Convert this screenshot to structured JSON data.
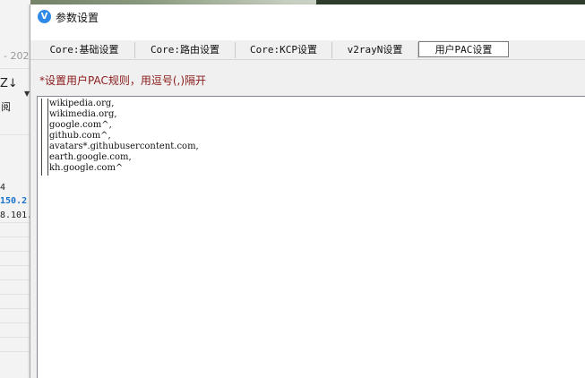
{
  "background_app": {
    "date_fragment": "- 202",
    "sort_icon_glyph": "Z↓",
    "sort_label": "阅",
    "rows": [
      "4",
      "150.2",
      "8.101."
    ]
  },
  "dialog": {
    "title": "参数设置",
    "tabs": [
      {
        "label": "Core:基础设置",
        "active": false
      },
      {
        "label": "Core:路由设置",
        "active": false
      },
      {
        "label": "Core:KCP设置",
        "active": false
      },
      {
        "label": "v2rayN设置",
        "active": false
      },
      {
        "label": "用户PAC设置",
        "active": true
      }
    ],
    "hint": "*设置用户PAC规则，用逗号(,)隔开",
    "editor_lines": [
      "wikipedia.org,",
      "wikimedia.org,",
      "google.com^,",
      "github.com^,",
      "avatars*.githubusercontent.com,",
      "earth.google.com,",
      "kh.google.com^"
    ]
  },
  "colors": {
    "hint_text": "#8b1a1a",
    "accent_blue": "#2e8ae6",
    "blue_row": "#1a73c8"
  }
}
